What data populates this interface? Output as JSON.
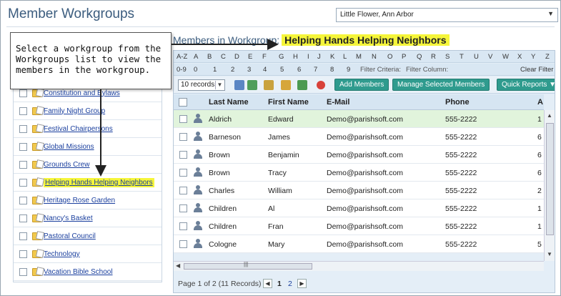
{
  "page": {
    "title": "Member Workgroups"
  },
  "parish_select": {
    "value": "Little Flower, Ann Arbor"
  },
  "callout": {
    "text": "Select a workgroup from the Workgroups list to view the members in the workgroup."
  },
  "workgroups": [
    {
      "label": "Constitution and Bylaws",
      "highlighted": false
    },
    {
      "label": "Family Night Group",
      "highlighted": false
    },
    {
      "label": "Festival Chairpersons",
      "highlighted": false
    },
    {
      "label": "Global Missions",
      "highlighted": false
    },
    {
      "label": "Grounds Crew",
      "highlighted": false
    },
    {
      "label": "Helping Hands Helping Neighbors",
      "highlighted": true
    },
    {
      "label": "Heritage Rose Garden",
      "highlighted": false
    },
    {
      "label": "Nancy's Basket",
      "highlighted": false
    },
    {
      "label": "Pastoral Council",
      "highlighted": false
    },
    {
      "label": "Technology",
      "highlighted": false
    },
    {
      "label": "Vacation Bible School",
      "highlighted": false
    }
  ],
  "members": {
    "title_prefix": "Members in Workgroup:",
    "workgroup_name": "Helping Hands Helping Neighbors",
    "alpha_row1": [
      "A-Z",
      "A",
      "B",
      "C",
      "D",
      "E",
      "F",
      "G",
      "H",
      "I",
      "J",
      "K",
      "L",
      "M",
      "N",
      "O",
      "P",
      "Q",
      "R",
      "S",
      "T",
      "U",
      "V",
      "W",
      "X",
      "Y",
      "Z"
    ],
    "alpha_row2": [
      "0-9",
      "0",
      "1",
      "2",
      "3",
      "4",
      "5",
      "6",
      "7",
      "8",
      "9"
    ],
    "filter_criteria_label": "Filter Criteria:",
    "filter_column_label": "Filter Column:",
    "clear_filter_label": "Clear Filter",
    "records_select": "10 records",
    "add_members_label": "Add Members",
    "manage_selected_label": "Manage Selected Members",
    "quick_reports_label": "Quick Reports ▼",
    "columns": [
      "Last Name",
      "First Name",
      "E-Mail",
      "Phone",
      "A"
    ],
    "rows": [
      {
        "last": "Aldrich",
        "first": "Edward",
        "email": "Demo@parishsoft.com",
        "phone": "555-2222",
        "extra": "1",
        "selected": true
      },
      {
        "last": "Barneson",
        "first": "James",
        "email": "Demo@parishsoft.com",
        "phone": "555-2222",
        "extra": "6",
        "selected": false
      },
      {
        "last": "Brown",
        "first": "Benjamin",
        "email": "Demo@parishsoft.com",
        "phone": "555-2222",
        "extra": "6",
        "selected": false
      },
      {
        "last": "Brown",
        "first": "Tracy",
        "email": "Demo@parishsoft.com",
        "phone": "555-2222",
        "extra": "6",
        "selected": false
      },
      {
        "last": "Charles",
        "first": "William",
        "email": "Demo@parishsoft.com",
        "phone": "555-2222",
        "extra": "2",
        "selected": false
      },
      {
        "last": "Children",
        "first": "Al",
        "email": "Demo@parishsoft.com",
        "phone": "555-2222",
        "extra": "1",
        "selected": false
      },
      {
        "last": "Children",
        "first": "Fran",
        "email": "Demo@parishsoft.com",
        "phone": "555-2222",
        "extra": "1",
        "selected": false
      },
      {
        "last": "Cologne",
        "first": "Mary",
        "email": "Demo@parishsoft.com",
        "phone": "555-2222",
        "extra": "5",
        "selected": false
      }
    ],
    "pager_info": "Page 1 of 2 (11 Records)",
    "pages": [
      "1",
      "2"
    ]
  },
  "colors": {
    "highlight": "#f5f53a",
    "accent_button": "#2f9b8e",
    "link": "#1a3f9e",
    "title": "#3b5c7e",
    "selected_row": "#e1f4dc"
  }
}
